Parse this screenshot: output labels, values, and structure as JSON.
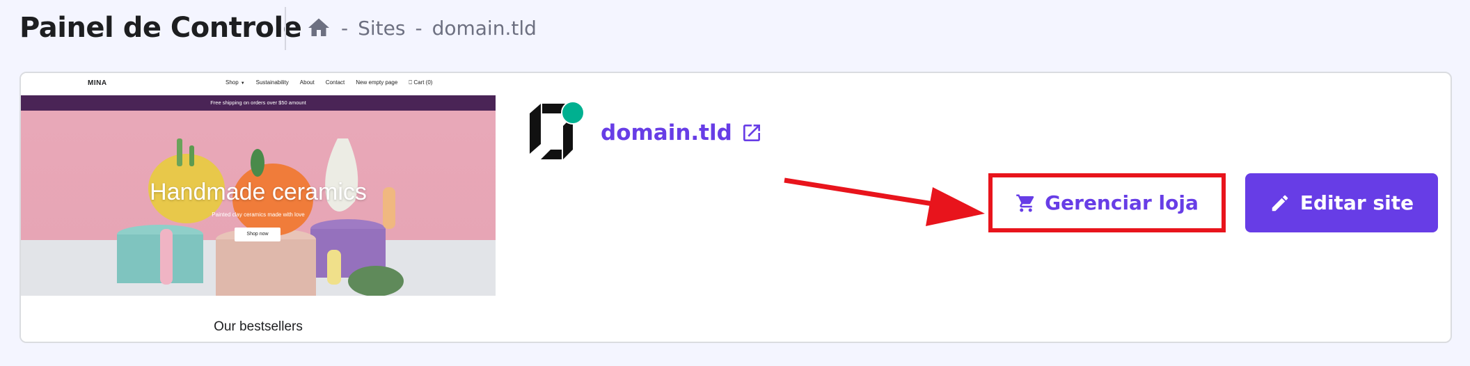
{
  "header": {
    "title": "Painel de Controle",
    "breadcrumb": {
      "home_icon": "home-icon",
      "separator": "-",
      "items": [
        "Sites",
        "domain.tld"
      ]
    }
  },
  "card": {
    "preview": {
      "brand": "MINA",
      "menu": [
        "Shop",
        "Sustainability",
        "About",
        "Contact",
        "New empty page",
        "Cart (0)"
      ],
      "banner": "Free shipping on orders over $50 amount",
      "hero_title": "Handmade ceramics",
      "hero_subtitle": "Painted clay ceramics made with love",
      "hero_button": "Shop now",
      "section_title": "Our bestsellers"
    },
    "site": {
      "domain": "domain.tld",
      "status_color": "#00b090",
      "external_icon": "external-link-icon"
    },
    "actions": {
      "manage_store_label": "Gerenciar loja",
      "manage_store_icon": "cart-icon",
      "edit_site_label": "Editar site",
      "edit_site_icon": "pencil-icon"
    }
  },
  "colors": {
    "accent": "#673de6",
    "highlight": "#e8141c",
    "background": "#f4f5ff"
  }
}
